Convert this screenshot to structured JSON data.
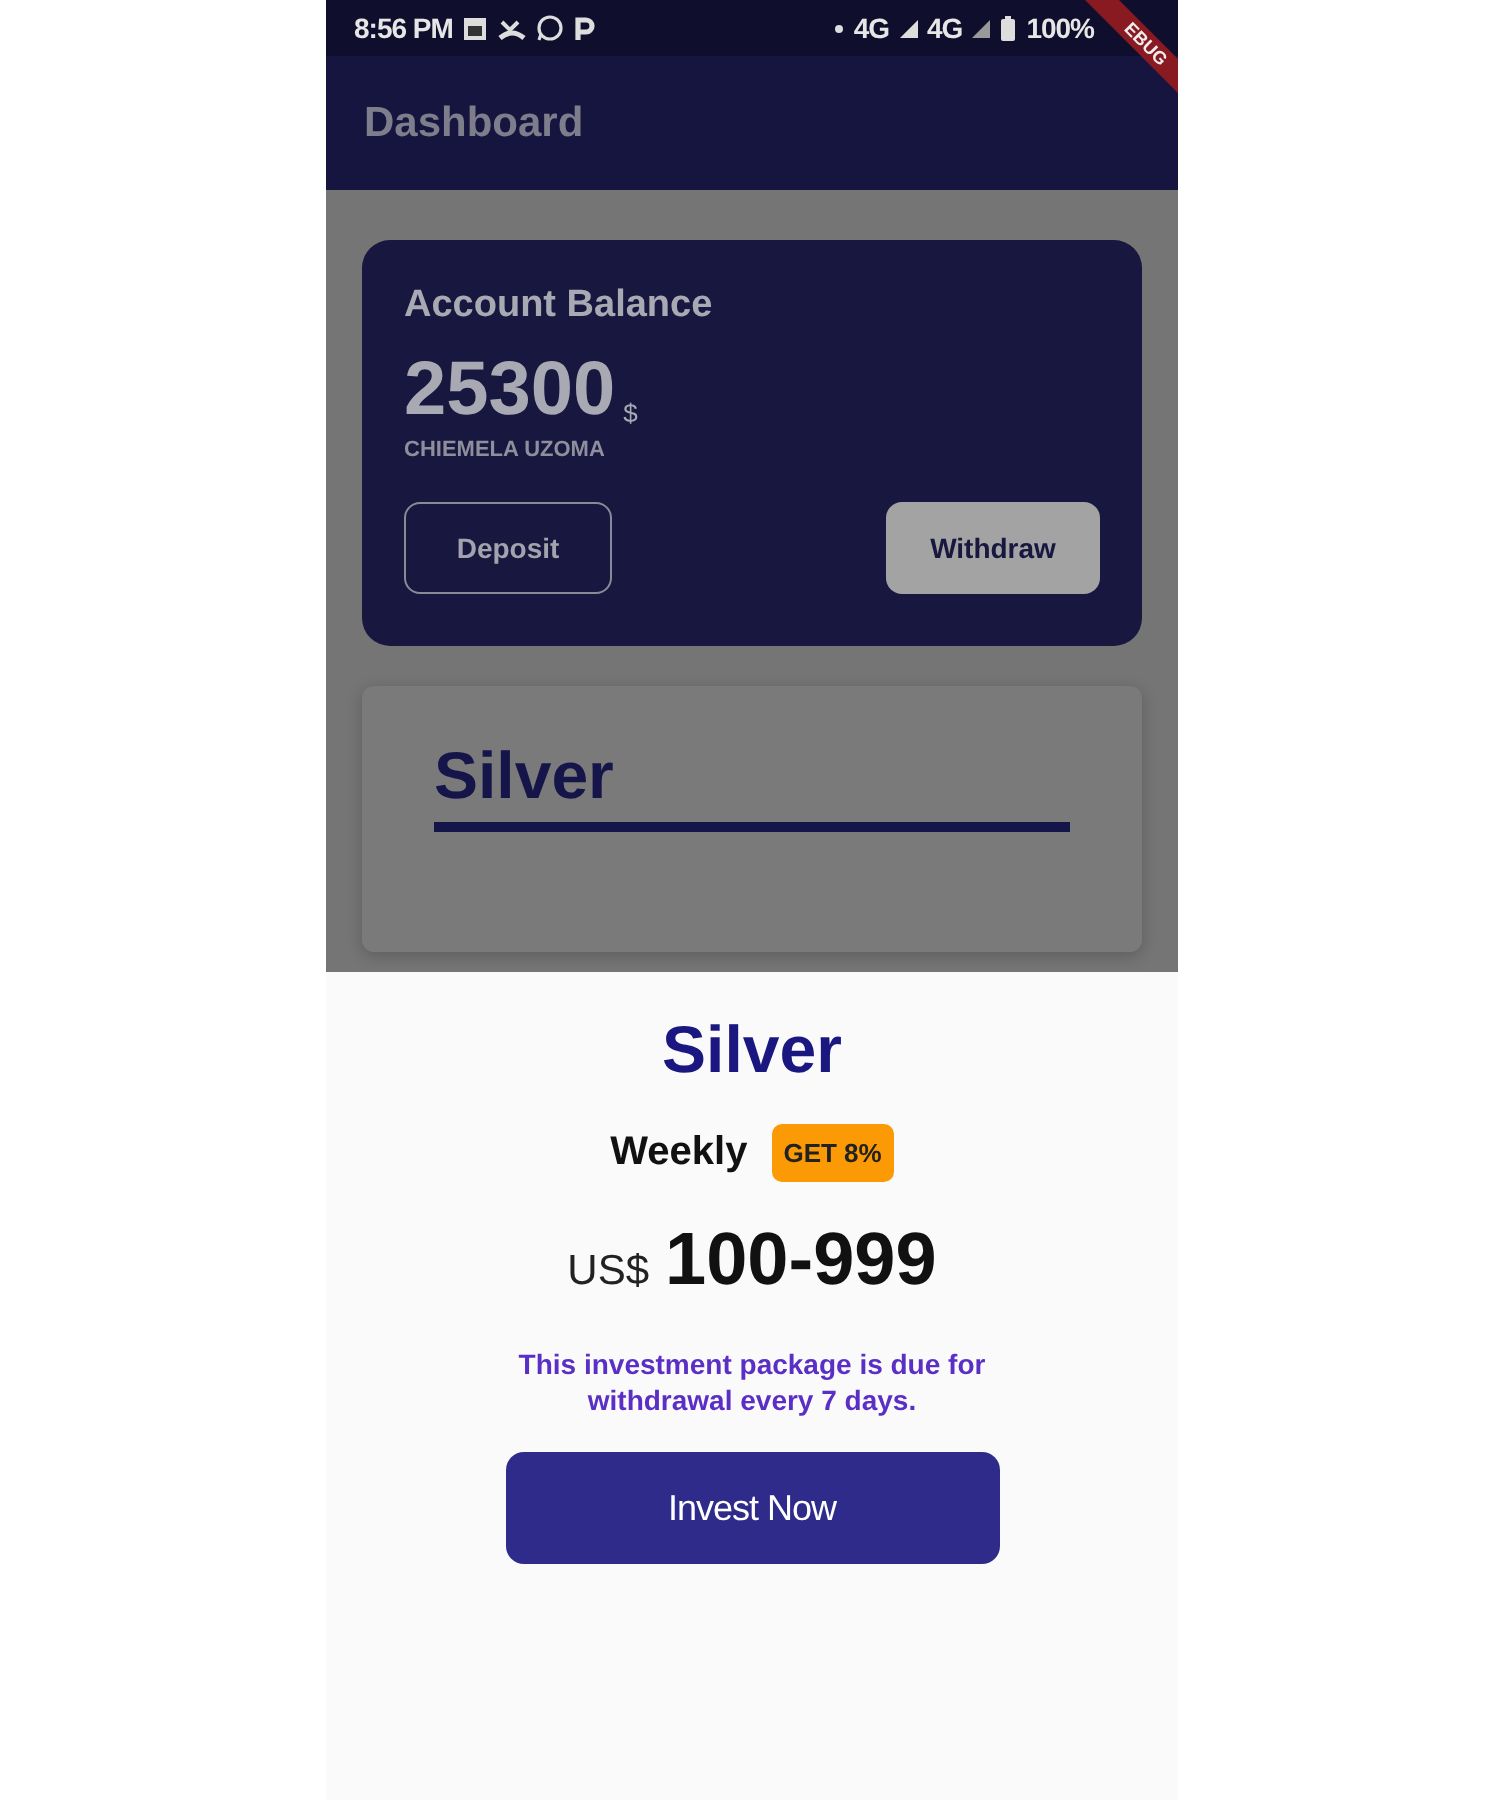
{
  "status_bar": {
    "time": "8:56 PM",
    "network_1": "4G",
    "network_2": "4G",
    "battery": "100%"
  },
  "debug_banner": {
    "text": "EBUG"
  },
  "app_bar": {
    "title": "Dashboard"
  },
  "balance_card": {
    "title": "Account Balance",
    "amount": "25300",
    "currency": "$",
    "owner": "CHIEMELA UZOMA",
    "buttons": [
      {
        "label": "Deposit",
        "kind": "outlined"
      },
      {
        "label": "Withdraw",
        "kind": "filled"
      }
    ]
  },
  "package_card": {
    "title": "Silver"
  },
  "bottom_sheet": {
    "title": "Silver",
    "frequency": "Weekly",
    "badge": "GET 8%",
    "currency": "US$",
    "range": "100-999",
    "description": "This investment package is due for withdrawal every 7 days.",
    "button": "Invest Now"
  }
}
